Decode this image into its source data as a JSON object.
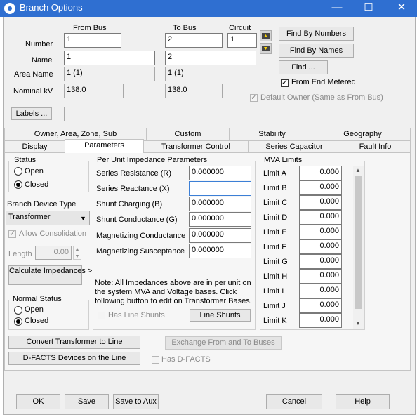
{
  "window": {
    "title": "Branch Options",
    "minimize": "—",
    "maximize": "☐",
    "close": "✕"
  },
  "header": {
    "from_bus_label": "From Bus",
    "to_bus_label": "To Bus",
    "circuit_label": "Circuit",
    "number_label": "Number",
    "name_label": "Name",
    "area_name_label": "Area Name",
    "nominal_kv_label": "Nominal kV",
    "from_number": "1",
    "to_number": "2",
    "circuit": "1",
    "from_name": "1",
    "to_name": "2",
    "from_area": "1 (1)",
    "to_area": "1 (1)",
    "from_kv": "138.0",
    "to_kv": "138.0",
    "find_by_numbers": "Find By Numbers",
    "find_by_names": "Find By Names",
    "find": "Find ...",
    "from_end_metered": "From End Metered",
    "default_owner": "Default Owner (Same as From Bus)",
    "labels_button": "Labels ...",
    "labels_value": ""
  },
  "tabs": {
    "row1": [
      "Owner, Area, Zone, Sub",
      "Custom",
      "Stability",
      "Geography"
    ],
    "row2": [
      "Display",
      "Parameters",
      "Transformer Control",
      "Series Capacitor",
      "Fault Info"
    ],
    "active": "Parameters"
  },
  "status": {
    "title": "Status",
    "open": "Open",
    "closed": "Closed",
    "selected": "Closed"
  },
  "device": {
    "type_label": "Branch Device Type",
    "type_value": "Transformer",
    "allow_consolidation": "Allow Consolidation",
    "length_label": "Length",
    "length_value": "0.00",
    "calculate_impedances": "Calculate Impedances >"
  },
  "normal_status": {
    "title": "Normal Status",
    "open": "Open",
    "closed": "Closed",
    "selected": "Closed"
  },
  "impedance": {
    "title": "Per Unit Impedance Parameters",
    "fields": [
      {
        "label": "Series Resistance (R)",
        "value": "0.000000"
      },
      {
        "label": "Series Reactance (X)",
        "value": ""
      },
      {
        "label": "Shunt Charging (B)",
        "value": "0.000000"
      },
      {
        "label": "Shunt Conductance (G)",
        "value": "0.000000"
      },
      {
        "label": "Magnetizing Conductance",
        "value": "0.000000"
      },
      {
        "label": "Magnetizing Susceptance",
        "value": "0.000000"
      }
    ],
    "note": "Note: All Impedances above are in per unit on the system MVA and Voltage bases. Click following button to edit on Transformer Bases.",
    "has_line_shunts": "Has Line Shunts",
    "line_shunts_button": "Line Shunts"
  },
  "mva": {
    "title": "MVA Limits",
    "limits": [
      {
        "label": "Limit A",
        "value": "0.000"
      },
      {
        "label": "Limit B",
        "value": "0.000"
      },
      {
        "label": "Limit C",
        "value": "0.000"
      },
      {
        "label": "Limit D",
        "value": "0.000"
      },
      {
        "label": "Limit E",
        "value": "0.000"
      },
      {
        "label": "Limit F",
        "value": "0.000"
      },
      {
        "label": "Limit G",
        "value": "0.000"
      },
      {
        "label": "Limit H",
        "value": "0.000"
      },
      {
        "label": "Limit I",
        "value": "0.000"
      },
      {
        "label": "Limit J",
        "value": "0.000"
      },
      {
        "label": "Limit K",
        "value": "0.000"
      }
    ]
  },
  "lower": {
    "convert_button": "Convert Transformer to Line",
    "exchange_button": "Exchange From and To Buses",
    "dfacts_button": "D-FACTS Devices on the Line",
    "has_dfacts": "Has D-FACTS"
  },
  "footer": {
    "ok": "OK",
    "save": "Save",
    "save_to_aux": "Save to Aux",
    "cancel": "Cancel",
    "help": "Help"
  }
}
